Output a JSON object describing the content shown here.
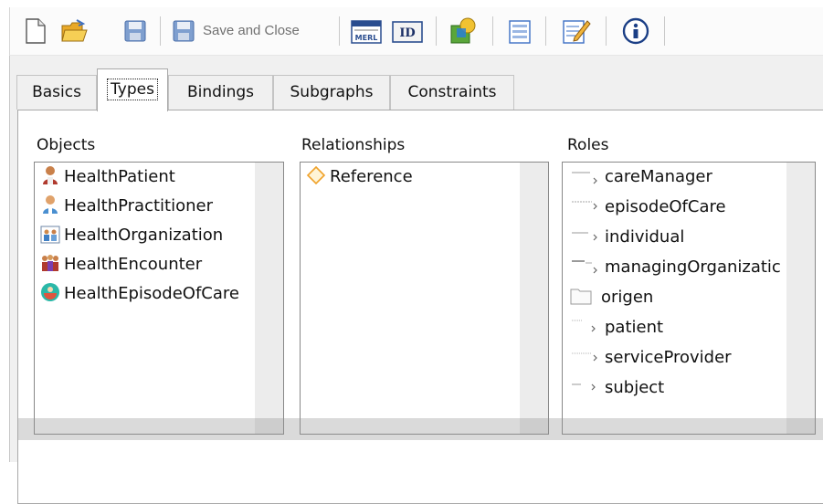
{
  "toolbar": {
    "save_and_close_label": "Save and Close",
    "buttons": [
      {
        "name": "new-document",
        "icon": "new-document-icon"
      },
      {
        "name": "open-folder",
        "icon": "open-folder-icon"
      },
      {
        "name": "save",
        "icon": "save-icon"
      },
      {
        "name": "save-and-close",
        "icon": "save-close-icon"
      },
      {
        "name": "merl",
        "icon": "merl-icon",
        "text": "MERL"
      },
      {
        "name": "id",
        "icon": "id-icon",
        "text": "ID"
      },
      {
        "name": "shapes",
        "icon": "shapes-icon"
      },
      {
        "name": "form",
        "icon": "form-icon"
      },
      {
        "name": "edit",
        "icon": "edit-icon"
      },
      {
        "name": "info",
        "icon": "info-icon"
      }
    ]
  },
  "tabs": [
    {
      "label": "Basics",
      "active": false
    },
    {
      "label": "Types",
      "active": true
    },
    {
      "label": "Bindings",
      "active": false
    },
    {
      "label": "Subgraphs",
      "active": false
    },
    {
      "label": "Constraints",
      "active": false
    }
  ],
  "objects": {
    "label": "Objects",
    "items": [
      {
        "label": "HealthPatient",
        "icon": "patient-icon"
      },
      {
        "label": "HealthPractitioner",
        "icon": "practitioner-icon"
      },
      {
        "label": "HealthOrganization",
        "icon": "organization-icon"
      },
      {
        "label": "HealthEncounter",
        "icon": "encounter-icon"
      },
      {
        "label": "HealthEpisodeOfCare",
        "icon": "episode-of-care-icon"
      }
    ]
  },
  "relationships": {
    "label": "Relationships",
    "items": [
      {
        "label": "Reference",
        "icon": "diamond-icon"
      }
    ]
  },
  "roles": {
    "label": "Roles",
    "items": [
      {
        "label": "careManager",
        "icon": "role-arrow-icon"
      },
      {
        "label": "episodeOfCare",
        "icon": "role-arrow-icon"
      },
      {
        "label": "individual",
        "icon": "role-arrow-icon"
      },
      {
        "label": "managingOrganizatic",
        "icon": "role-arrow-icon"
      },
      {
        "label": "origen",
        "icon": "folder-icon"
      },
      {
        "label": "patient",
        "icon": "role-arrow-icon"
      },
      {
        "label": "serviceProvider",
        "icon": "role-arrow-icon"
      },
      {
        "label": "subject",
        "icon": "role-arrow-icon"
      }
    ]
  },
  "colors": {
    "toolbar_icon_blue": "#3c6fc4",
    "folder_yellow": "#f2c23c",
    "diamond_orange": "#f0a22a",
    "tab_border": "#a9a9a9",
    "panel_bg": "#f0f0f0"
  }
}
